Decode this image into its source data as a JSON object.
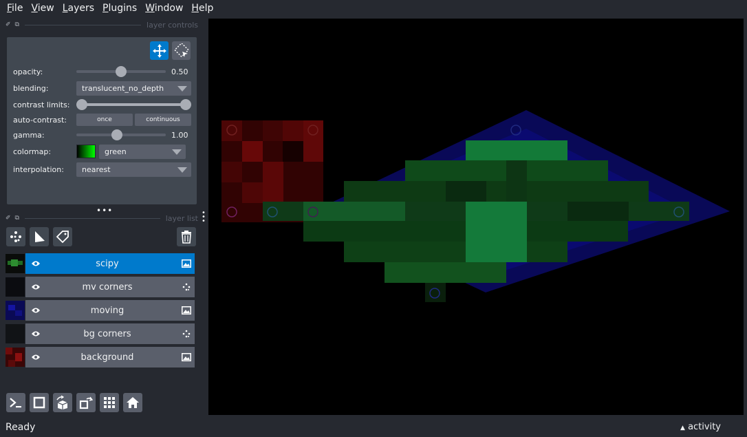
{
  "menu": [
    {
      "label": "File",
      "accel": "F",
      "rest": "ile"
    },
    {
      "label": "View",
      "accel": "V",
      "rest": "iew"
    },
    {
      "label": "Layers",
      "accel": "L",
      "rest": "ayers"
    },
    {
      "label": "Plugins",
      "accel": "P",
      "rest": "lugins"
    },
    {
      "label": "Window",
      "accel": "W",
      "rest": "indow"
    },
    {
      "label": "Help",
      "accel": "H",
      "rest": "elp"
    }
  ],
  "layer_controls": {
    "title": "layer controls",
    "opacity_label": "opacity:",
    "opacity_value": "0.50",
    "opacity_fraction": 0.5,
    "blending_label": "blending:",
    "blending_value": "translucent_no_depth",
    "contrast_label": "contrast limits:",
    "contrast_range": [
      0.0,
      1.0
    ],
    "autocontrast_label": "auto-contrast:",
    "once_label": "once",
    "continuous_label": "continuous",
    "gamma_label": "gamma:",
    "gamma_value": "1.00",
    "gamma_fraction": 0.45,
    "colormap_label": "colormap:",
    "colormap_value": "green",
    "interpolation_label": "interpolation:",
    "interpolation_value": "nearest"
  },
  "layer_list": {
    "title": "layer list",
    "layers": [
      {
        "name": "scipy",
        "type": "image",
        "selected": true,
        "thumb_color": "#0f3a12"
      },
      {
        "name": "mv corners",
        "type": "points",
        "selected": false,
        "thumb_color": "#0b0c10"
      },
      {
        "name": "moving",
        "type": "image",
        "selected": false,
        "thumb_color": "#0a0a6a"
      },
      {
        "name": "bg corners",
        "type": "points",
        "selected": false,
        "thumb_color": "#111316"
      },
      {
        "name": "background",
        "type": "image",
        "selected": false,
        "thumb_color": "#5a0a0a"
      }
    ]
  },
  "colors": {
    "accent": "#007acc",
    "panel": "#414851",
    "widget": "#5a5f6b",
    "background": "#262930"
  },
  "status": {
    "text": "Ready",
    "activity_label": "activity"
  }
}
